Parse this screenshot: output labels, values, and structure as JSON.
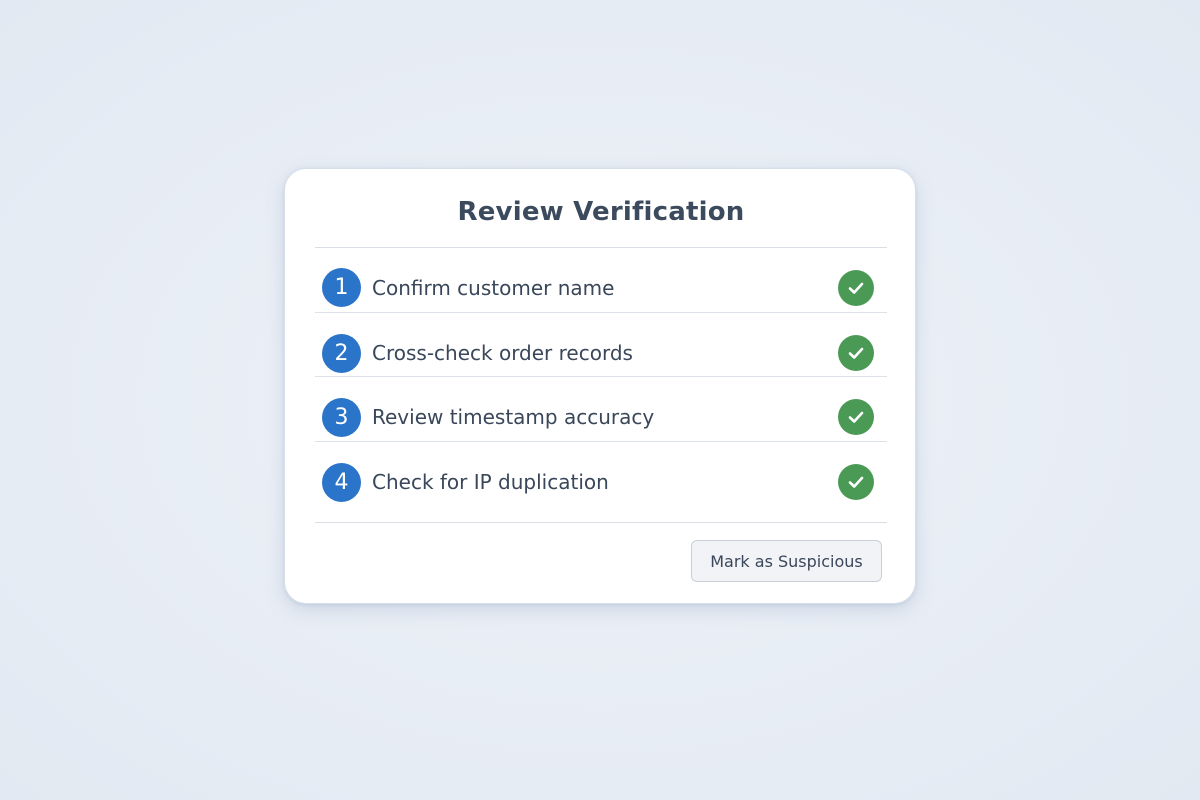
{
  "card": {
    "title": "Review Verification"
  },
  "steps": [
    {
      "number": "1",
      "label": "Confirm customer name",
      "status": "complete",
      "status_icon": "check-circle-icon"
    },
    {
      "number": "2",
      "label": "Cross-check order records",
      "status": "complete",
      "status_icon": "check-circle-icon"
    },
    {
      "number": "3",
      "label": "Review timestamp accuracy",
      "status": "complete",
      "status_icon": "check-circle-icon"
    },
    {
      "number": "4",
      "label": "Check for IP duplication",
      "status": "complete",
      "status_icon": "check-circle-icon"
    }
  ],
  "actions": {
    "suspicious_label": "Mark as Suspicious"
  },
  "colors": {
    "step_badge": "#2a74c9",
    "check_complete": "#4a9a56",
    "text": "#3a475a"
  }
}
